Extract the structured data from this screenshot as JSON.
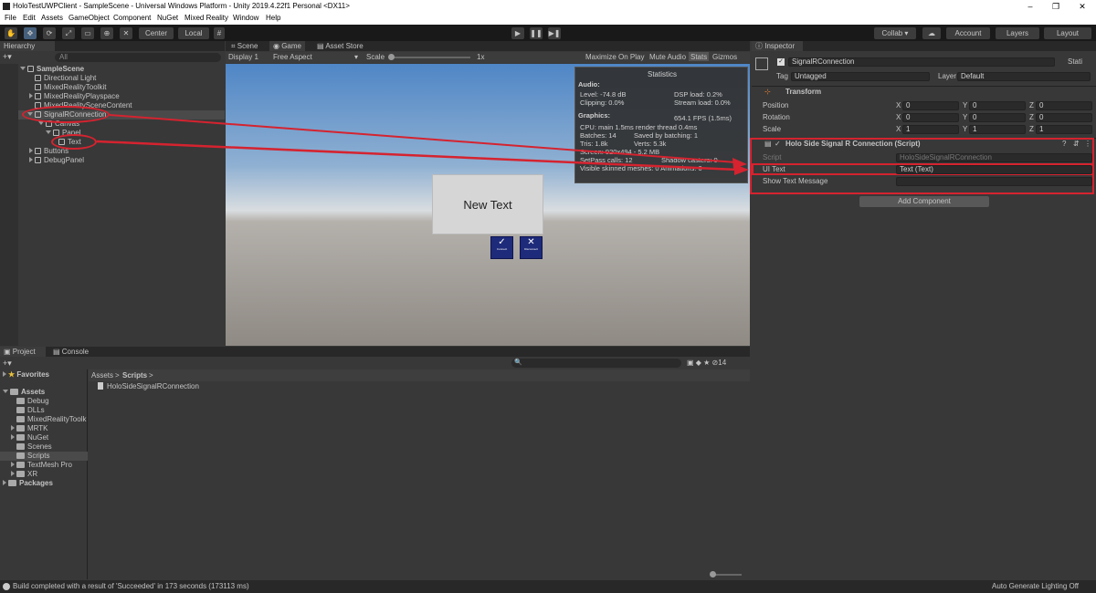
{
  "window": {
    "title": "HoloTestUWPClient - SampleScene - Universal Windows Platform - Unity 2019.4.22f1 Personal <DX11>",
    "minimize": "–",
    "maximize": "❐",
    "close": "✕"
  },
  "menu": [
    "File",
    "Edit",
    "Assets",
    "GameObject",
    "Component",
    "NuGet",
    "Mixed Reality",
    "Window",
    "Help"
  ],
  "toolbar": {
    "pivot": "Center",
    "space": "Local",
    "collab": "Collab ▾",
    "account": "Account",
    "layers": "Layers",
    "layout": "Layout",
    "play": "▶",
    "pause": "❚❚",
    "step": "▶❚"
  },
  "hierarchy": {
    "tab": "Hierarchy",
    "search_placeholder": "All",
    "scene": "SampleScene",
    "items": [
      "Directional Light",
      "MixedRealityToolkit",
      "MixedRealityPlayspace",
      "MixedRealitySceneContent",
      "SignalRConnection",
      "Canvas",
      "Panel",
      "Text",
      "Buttons",
      "DebugPanel"
    ]
  },
  "game": {
    "tabs": [
      "Scene",
      "Game",
      "Asset Store"
    ],
    "display": "Display 1",
    "aspect": "Free Aspect",
    "scale_label": "Scale",
    "scale_value": "1x",
    "maximize": "Maximize On Play",
    "mute": "Mute Audio",
    "stats": "Stats",
    "gizmos": "Gizmos",
    "panel_text": "New Text",
    "btn1": "Connect",
    "btn2": "Disconnect"
  },
  "stats": {
    "title": "Statistics",
    "audio": "Audio:",
    "level": "Level: -74.8 dB",
    "dsp": "DSP load: 0.2%",
    "clipping": "Clipping: 0.0%",
    "stream": "Stream load: 0.0%",
    "graphics": "Graphics:",
    "fps": "654.1 FPS (1.5ms)",
    "cpu": "CPU: main 1.5ms  render thread 0.4ms",
    "batches": "Batches: 14",
    "saved": "Saved by batching: 1",
    "tris": "Tris: 1.8k",
    "verts": "Verts: 5.3k",
    "screen": "Screen: 920x494 - 5.2 MB",
    "setpass": "SetPass calls: 12",
    "shadow": "Shadow casters: 0",
    "skinned": "Visible skinned meshes: 0  Animations: 0"
  },
  "inspector": {
    "tab": "Inspector",
    "name": "SignalRConnection",
    "static": "Stati",
    "tag_label": "Tag",
    "tag": "Untagged",
    "layer_label": "Layer",
    "layer": "Default",
    "transform": "Transform",
    "position": "Position",
    "rotation": "Rotation",
    "scale": "Scale",
    "pos": [
      "0",
      "0",
      "0"
    ],
    "rot": [
      "0",
      "0",
      "0"
    ],
    "scl": [
      "1",
      "1",
      "1"
    ],
    "axes": [
      "X",
      "Y",
      "Z"
    ],
    "component": "Holo Side Signal R Connection (Script)",
    "script_label": "Script",
    "script": "HoloSideSignalRConnection",
    "uitext_label": "UI Text",
    "uitext": "Text (Text)",
    "show_label": "Show Text Message",
    "add": "Add Component"
  },
  "project": {
    "tabs": [
      "Project",
      "Console"
    ],
    "favorites": "Favorites",
    "assets": "Assets",
    "folders": [
      "Debug",
      "DLLs",
      "MixedRealityToolk",
      "MRTK",
      "NuGet",
      "Scenes",
      "Scripts",
      "TextMesh Pro",
      "XR"
    ],
    "packages": "Packages",
    "breadcrumb": [
      "Assets",
      "Scripts"
    ],
    "file": "HoloSideSignalRConnection",
    "count": "14"
  },
  "status": {
    "left": "Build completed with a result of 'Succeeded' in 173 seconds (173113 ms)",
    "right": "Auto Generate Lighting Off"
  }
}
